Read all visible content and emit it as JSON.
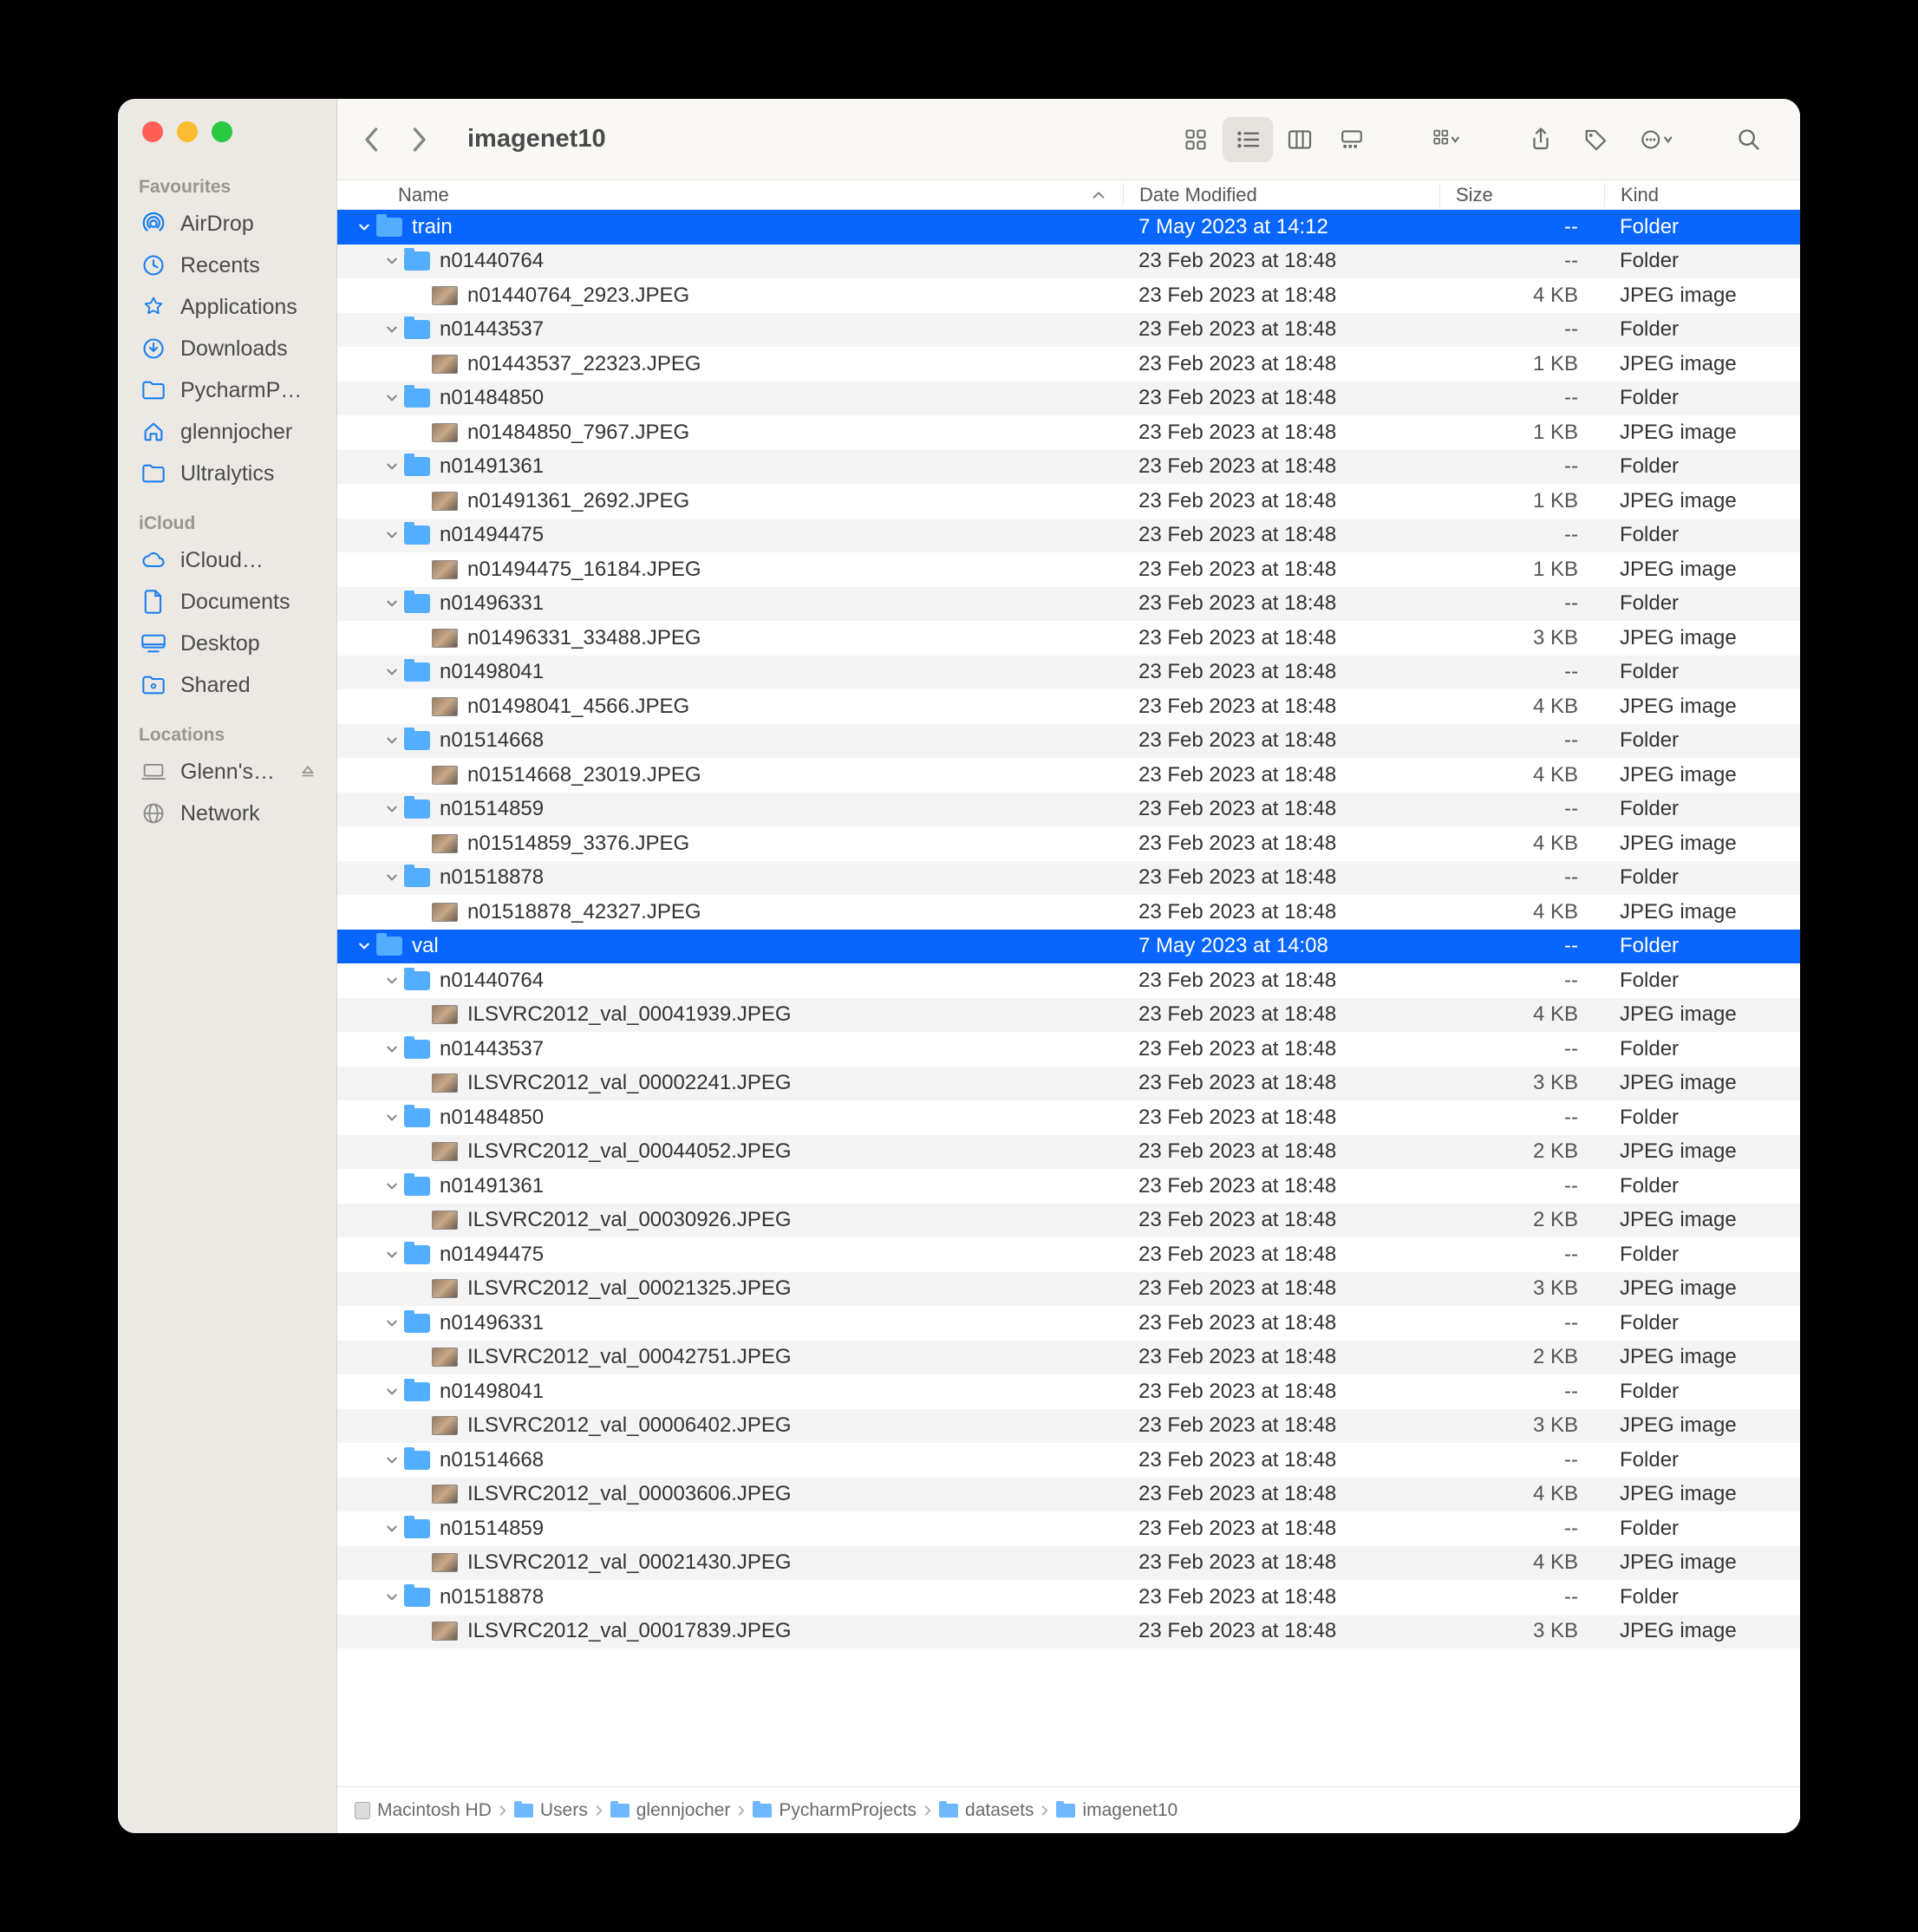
{
  "window_title": "imagenet10",
  "sidebar": {
    "sections": [
      {
        "title": "Favourites",
        "items": [
          {
            "id": "airdrop",
            "label": "AirDrop",
            "icon": "airdrop"
          },
          {
            "id": "recents",
            "label": "Recents",
            "icon": "clock"
          },
          {
            "id": "applications",
            "label": "Applications",
            "icon": "apps"
          },
          {
            "id": "downloads",
            "label": "Downloads",
            "icon": "download"
          },
          {
            "id": "pycharm",
            "label": "PycharmP…",
            "icon": "folder"
          },
          {
            "id": "glennjocher",
            "label": "glennjocher",
            "icon": "home"
          },
          {
            "id": "ultralytics",
            "label": "Ultralytics",
            "icon": "folder"
          }
        ]
      },
      {
        "title": "iCloud",
        "items": [
          {
            "id": "iclouddrive",
            "label": "iCloud…",
            "icon": "cloud"
          },
          {
            "id": "documents",
            "label": "Documents",
            "icon": "doc"
          },
          {
            "id": "desktop",
            "label": "Desktop",
            "icon": "desktop"
          },
          {
            "id": "shared",
            "label": "Shared",
            "icon": "shared"
          }
        ]
      },
      {
        "title": "Locations",
        "items": [
          {
            "id": "glenns",
            "label": "Glenn's…",
            "icon": "laptop",
            "eject": true,
            "gray": true
          },
          {
            "id": "network",
            "label": "Network",
            "icon": "globe",
            "gray": true
          }
        ]
      }
    ]
  },
  "columns": {
    "name": "Name",
    "date": "Date Modified",
    "size": "Size",
    "kind": "Kind"
  },
  "rows": [
    {
      "depth": 0,
      "expand": "open",
      "type": "folder",
      "name": "train",
      "date": "7 May 2023 at 14:12",
      "size": "--",
      "kind": "Folder",
      "selected": true
    },
    {
      "depth": 1,
      "expand": "open",
      "type": "folder",
      "name": "n01440764",
      "date": "23 Feb 2023 at 18:48",
      "size": "--",
      "kind": "Folder"
    },
    {
      "depth": 2,
      "expand": "none",
      "type": "image",
      "name": "n01440764_2923.JPEG",
      "date": "23 Feb 2023 at 18:48",
      "size": "4 KB",
      "kind": "JPEG image"
    },
    {
      "depth": 1,
      "expand": "open",
      "type": "folder",
      "name": "n01443537",
      "date": "23 Feb 2023 at 18:48",
      "size": "--",
      "kind": "Folder"
    },
    {
      "depth": 2,
      "expand": "none",
      "type": "image",
      "name": "n01443537_22323.JPEG",
      "date": "23 Feb 2023 at 18:48",
      "size": "1 KB",
      "kind": "JPEG image"
    },
    {
      "depth": 1,
      "expand": "open",
      "type": "folder",
      "name": "n01484850",
      "date": "23 Feb 2023 at 18:48",
      "size": "--",
      "kind": "Folder"
    },
    {
      "depth": 2,
      "expand": "none",
      "type": "image",
      "name": "n01484850_7967.JPEG",
      "date": "23 Feb 2023 at 18:48",
      "size": "1 KB",
      "kind": "JPEG image"
    },
    {
      "depth": 1,
      "expand": "open",
      "type": "folder",
      "name": "n01491361",
      "date": "23 Feb 2023 at 18:48",
      "size": "--",
      "kind": "Folder"
    },
    {
      "depth": 2,
      "expand": "none",
      "type": "image",
      "name": "n01491361_2692.JPEG",
      "date": "23 Feb 2023 at 18:48",
      "size": "1 KB",
      "kind": "JPEG image"
    },
    {
      "depth": 1,
      "expand": "open",
      "type": "folder",
      "name": "n01494475",
      "date": "23 Feb 2023 at 18:48",
      "size": "--",
      "kind": "Folder"
    },
    {
      "depth": 2,
      "expand": "none",
      "type": "image",
      "name": "n01494475_16184.JPEG",
      "date": "23 Feb 2023 at 18:48",
      "size": "1 KB",
      "kind": "JPEG image"
    },
    {
      "depth": 1,
      "expand": "open",
      "type": "folder",
      "name": "n01496331",
      "date": "23 Feb 2023 at 18:48",
      "size": "--",
      "kind": "Folder"
    },
    {
      "depth": 2,
      "expand": "none",
      "type": "image",
      "name": "n01496331_33488.JPEG",
      "date": "23 Feb 2023 at 18:48",
      "size": "3 KB",
      "kind": "JPEG image"
    },
    {
      "depth": 1,
      "expand": "open",
      "type": "folder",
      "name": "n01498041",
      "date": "23 Feb 2023 at 18:48",
      "size": "--",
      "kind": "Folder"
    },
    {
      "depth": 2,
      "expand": "none",
      "type": "image",
      "name": "n01498041_4566.JPEG",
      "date": "23 Feb 2023 at 18:48",
      "size": "4 KB",
      "kind": "JPEG image"
    },
    {
      "depth": 1,
      "expand": "open",
      "type": "folder",
      "name": "n01514668",
      "date": "23 Feb 2023 at 18:48",
      "size": "--",
      "kind": "Folder"
    },
    {
      "depth": 2,
      "expand": "none",
      "type": "image",
      "name": "n01514668_23019.JPEG",
      "date": "23 Feb 2023 at 18:48",
      "size": "4 KB",
      "kind": "JPEG image"
    },
    {
      "depth": 1,
      "expand": "open",
      "type": "folder",
      "name": "n01514859",
      "date": "23 Feb 2023 at 18:48",
      "size": "--",
      "kind": "Folder"
    },
    {
      "depth": 2,
      "expand": "none",
      "type": "image",
      "name": "n01514859_3376.JPEG",
      "date": "23 Feb 2023 at 18:48",
      "size": "4 KB",
      "kind": "JPEG image"
    },
    {
      "depth": 1,
      "expand": "open",
      "type": "folder",
      "name": "n01518878",
      "date": "23 Feb 2023 at 18:48",
      "size": "--",
      "kind": "Folder"
    },
    {
      "depth": 2,
      "expand": "none",
      "type": "image",
      "name": "n01518878_42327.JPEG",
      "date": "23 Feb 2023 at 18:48",
      "size": "4 KB",
      "kind": "JPEG image"
    },
    {
      "depth": 0,
      "expand": "open",
      "type": "folder",
      "name": "val",
      "date": "7 May 2023 at 14:08",
      "size": "--",
      "kind": "Folder",
      "selected": true
    },
    {
      "depth": 1,
      "expand": "open",
      "type": "folder",
      "name": "n01440764",
      "date": "23 Feb 2023 at 18:48",
      "size": "--",
      "kind": "Folder"
    },
    {
      "depth": 2,
      "expand": "none",
      "type": "image",
      "name": "ILSVRC2012_val_00041939.JPEG",
      "date": "23 Feb 2023 at 18:48",
      "size": "4 KB",
      "kind": "JPEG image"
    },
    {
      "depth": 1,
      "expand": "open",
      "type": "folder",
      "name": "n01443537",
      "date": "23 Feb 2023 at 18:48",
      "size": "--",
      "kind": "Folder"
    },
    {
      "depth": 2,
      "expand": "none",
      "type": "image",
      "name": "ILSVRC2012_val_00002241.JPEG",
      "date": "23 Feb 2023 at 18:48",
      "size": "3 KB",
      "kind": "JPEG image"
    },
    {
      "depth": 1,
      "expand": "open",
      "type": "folder",
      "name": "n01484850",
      "date": "23 Feb 2023 at 18:48",
      "size": "--",
      "kind": "Folder"
    },
    {
      "depth": 2,
      "expand": "none",
      "type": "image",
      "name": "ILSVRC2012_val_00044052.JPEG",
      "date": "23 Feb 2023 at 18:48",
      "size": "2 KB",
      "kind": "JPEG image"
    },
    {
      "depth": 1,
      "expand": "open",
      "type": "folder",
      "name": "n01491361",
      "date": "23 Feb 2023 at 18:48",
      "size": "--",
      "kind": "Folder"
    },
    {
      "depth": 2,
      "expand": "none",
      "type": "image",
      "name": "ILSVRC2012_val_00030926.JPEG",
      "date": "23 Feb 2023 at 18:48",
      "size": "2 KB",
      "kind": "JPEG image"
    },
    {
      "depth": 1,
      "expand": "open",
      "type": "folder",
      "name": "n01494475",
      "date": "23 Feb 2023 at 18:48",
      "size": "--",
      "kind": "Folder"
    },
    {
      "depth": 2,
      "expand": "none",
      "type": "image",
      "name": "ILSVRC2012_val_00021325.JPEG",
      "date": "23 Feb 2023 at 18:48",
      "size": "3 KB",
      "kind": "JPEG image"
    },
    {
      "depth": 1,
      "expand": "open",
      "type": "folder",
      "name": "n01496331",
      "date": "23 Feb 2023 at 18:48",
      "size": "--",
      "kind": "Folder"
    },
    {
      "depth": 2,
      "expand": "none",
      "type": "image",
      "name": "ILSVRC2012_val_00042751.JPEG",
      "date": "23 Feb 2023 at 18:48",
      "size": "2 KB",
      "kind": "JPEG image"
    },
    {
      "depth": 1,
      "expand": "open",
      "type": "folder",
      "name": "n01498041",
      "date": "23 Feb 2023 at 18:48",
      "size": "--",
      "kind": "Folder"
    },
    {
      "depth": 2,
      "expand": "none",
      "type": "image",
      "name": "ILSVRC2012_val_00006402.JPEG",
      "date": "23 Feb 2023 at 18:48",
      "size": "3 KB",
      "kind": "JPEG image"
    },
    {
      "depth": 1,
      "expand": "open",
      "type": "folder",
      "name": "n01514668",
      "date": "23 Feb 2023 at 18:48",
      "size": "--",
      "kind": "Folder"
    },
    {
      "depth": 2,
      "expand": "none",
      "type": "image",
      "name": "ILSVRC2012_val_00003606.JPEG",
      "date": "23 Feb 2023 at 18:48",
      "size": "4 KB",
      "kind": "JPEG image"
    },
    {
      "depth": 1,
      "expand": "open",
      "type": "folder",
      "name": "n01514859",
      "date": "23 Feb 2023 at 18:48",
      "size": "--",
      "kind": "Folder"
    },
    {
      "depth": 2,
      "expand": "none",
      "type": "image",
      "name": "ILSVRC2012_val_00021430.JPEG",
      "date": "23 Feb 2023 at 18:48",
      "size": "4 KB",
      "kind": "JPEG image"
    },
    {
      "depth": 1,
      "expand": "open",
      "type": "folder",
      "name": "n01518878",
      "date": "23 Feb 2023 at 18:48",
      "size": "--",
      "kind": "Folder"
    },
    {
      "depth": 2,
      "expand": "none",
      "type": "image",
      "name": "ILSVRC2012_val_00017839.JPEG",
      "date": "23 Feb 2023 at 18:48",
      "size": "3 KB",
      "kind": "JPEG image"
    }
  ],
  "pathbar": [
    "Macintosh HD",
    "Users",
    "glennjocher",
    "PycharmProjects",
    "datasets",
    "imagenet10"
  ]
}
